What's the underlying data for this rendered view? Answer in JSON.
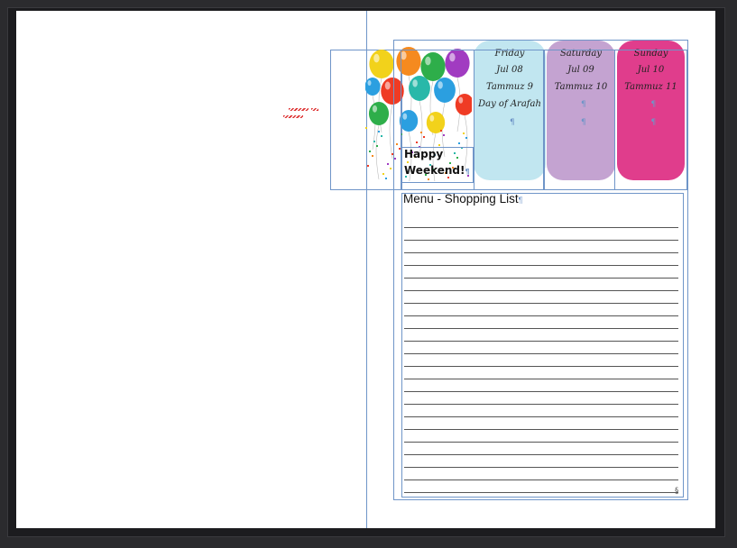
{
  "days": [
    {
      "lines": [
        "Friday",
        "Jul 08",
        "Tammuz 9",
        "Day of Arafah"
      ],
      "color": "#c1e6f0"
    },
    {
      "lines": [
        "Saturday",
        "Jul 09",
        "Tammuz 10"
      ],
      "color": "#c4a3d1"
    },
    {
      "lines": [
        "Sunday",
        "Jul 10",
        "Tammuz 11"
      ],
      "color": "#e03d8c"
    }
  ],
  "banner": {
    "line1": "Happy",
    "line2": "Weekend!"
  },
  "menu": {
    "title": "Menu - Shopping List",
    "line_count": 22
  },
  "marks": {
    "pilcrow": "¶",
    "section": "§"
  },
  "colors": {
    "guide": "#6f95c8",
    "balloons": [
      "#f2d21b",
      "#ef3b24",
      "#2eae4a",
      "#2b9fe0",
      "#a13bc1",
      "#f58a1f",
      "#29b8a9"
    ]
  }
}
